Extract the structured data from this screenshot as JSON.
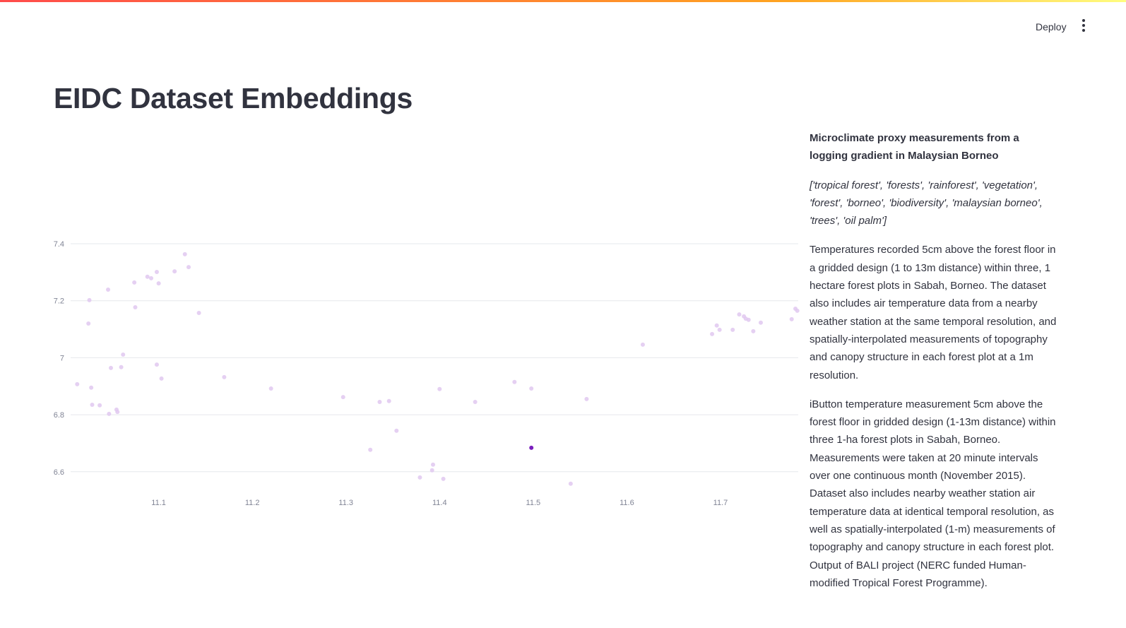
{
  "header": {
    "deploy_label": "Deploy",
    "menu_icon": "more-vertical-icon"
  },
  "page": {
    "title": "EIDC Dataset Embeddings"
  },
  "detail": {
    "title": "Microclimate proxy measurements from a logging gradient in Malaysian Borneo",
    "keywords": "['tropical forest', 'forests', 'rainforest', 'vegetation', 'forest', 'borneo', 'biodiversity', 'malaysian borneo', 'trees', 'oil palm']",
    "description": "Temperatures recorded 5cm above the forest floor in a gridded design (1 to 13m distance) within three, 1 hectare forest plots in Sabah, Borneo. The dataset also includes air temperature data from a nearby weather station at the same temporal resolution, and spatially-interpolated measurements of topography and canopy structure in each forest plot at a 1m resolution.",
    "abstract": "iButton temperature measurement 5cm above the forest floor in gridded design (1-13m distance) within three 1-ha forest plots in Sabah, Borneo. Measurements were taken at 20 minute intervals over one continuous month (November 2015). Dataset also includes nearby weather station air temperature data at identical temporal resolution, as well as spatially-interpolated (1-m) measurements of topography and canopy structure in each forest plot. Output of BALI project (NERC funded Human-modified Tropical Forest Programme)."
  },
  "chart_data": {
    "type": "scatter",
    "title": "",
    "xlabel": "",
    "ylabel": "",
    "xlim": [
      11.006,
      11.783
    ],
    "ylim": [
      6.545,
      7.4
    ],
    "xticks": [
      11.1,
      11.2,
      11.3,
      11.4,
      11.5,
      11.6,
      11.7
    ],
    "xtick_labels": [
      "11.1",
      "11.2",
      "11.3",
      "11.4",
      "11.5",
      "11.6",
      "11.7"
    ],
    "yticks": [
      6.6,
      6.8,
      7.0,
      7.2,
      7.4
    ],
    "ytick_labels": [
      "6.6",
      "6.8",
      "7",
      "7.2",
      "7.4"
    ],
    "grid": "horizontal",
    "colors": {
      "point": "#e0c8f0",
      "selected": "#7a1fbd",
      "grid": "#e6e8ec",
      "tick": "#808495"
    },
    "points": [
      [
        11.013,
        6.907
      ],
      [
        11.026,
        7.202
      ],
      [
        11.025,
        7.12
      ],
      [
        11.028,
        6.895
      ],
      [
        11.029,
        6.835
      ],
      [
        11.037,
        6.833
      ],
      [
        11.046,
        7.239
      ],
      [
        11.047,
        6.803
      ],
      [
        11.049,
        6.964
      ],
      [
        11.055,
        6.818
      ],
      [
        11.056,
        6.81
      ],
      [
        11.06,
        6.967
      ],
      [
        11.062,
        7.011
      ],
      [
        11.074,
        7.264
      ],
      [
        11.075,
        7.177
      ],
      [
        11.088,
        7.284
      ],
      [
        11.092,
        7.279
      ],
      [
        11.098,
        7.301
      ],
      [
        11.1,
        7.261
      ],
      [
        11.098,
        6.976
      ],
      [
        11.103,
        6.927
      ],
      [
        11.117,
        7.303
      ],
      [
        11.128,
        7.363
      ],
      [
        11.132,
        7.318
      ],
      [
        11.143,
        7.157
      ],
      [
        11.17,
        6.932
      ],
      [
        11.22,
        6.892
      ],
      [
        11.297,
        6.862
      ],
      [
        11.326,
        6.677
      ],
      [
        11.336,
        6.845
      ],
      [
        11.346,
        6.848
      ],
      [
        11.354,
        6.744
      ],
      [
        11.379,
        6.58
      ],
      [
        11.392,
        6.605
      ],
      [
        11.393,
        6.625
      ],
      [
        11.4,
        6.89
      ],
      [
        11.404,
        6.575
      ],
      [
        11.438,
        6.845
      ],
      [
        11.48,
        6.915
      ],
      [
        11.498,
        6.892
      ],
      [
        11.54,
        6.558
      ],
      [
        11.557,
        6.855
      ],
      [
        11.617,
        7.046
      ],
      [
        11.691,
        7.083
      ],
      [
        11.696,
        7.113
      ],
      [
        11.699,
        7.098
      ],
      [
        11.713,
        7.098
      ],
      [
        11.72,
        7.152
      ],
      [
        11.725,
        7.145
      ],
      [
        11.727,
        7.137
      ],
      [
        11.73,
        7.133
      ],
      [
        11.735,
        7.093
      ],
      [
        11.743,
        7.123
      ],
      [
        11.776,
        7.135
      ],
      [
        11.78,
        7.172
      ],
      [
        11.782,
        7.165
      ]
    ],
    "selected_point": [
      11.498,
      6.684
    ]
  }
}
